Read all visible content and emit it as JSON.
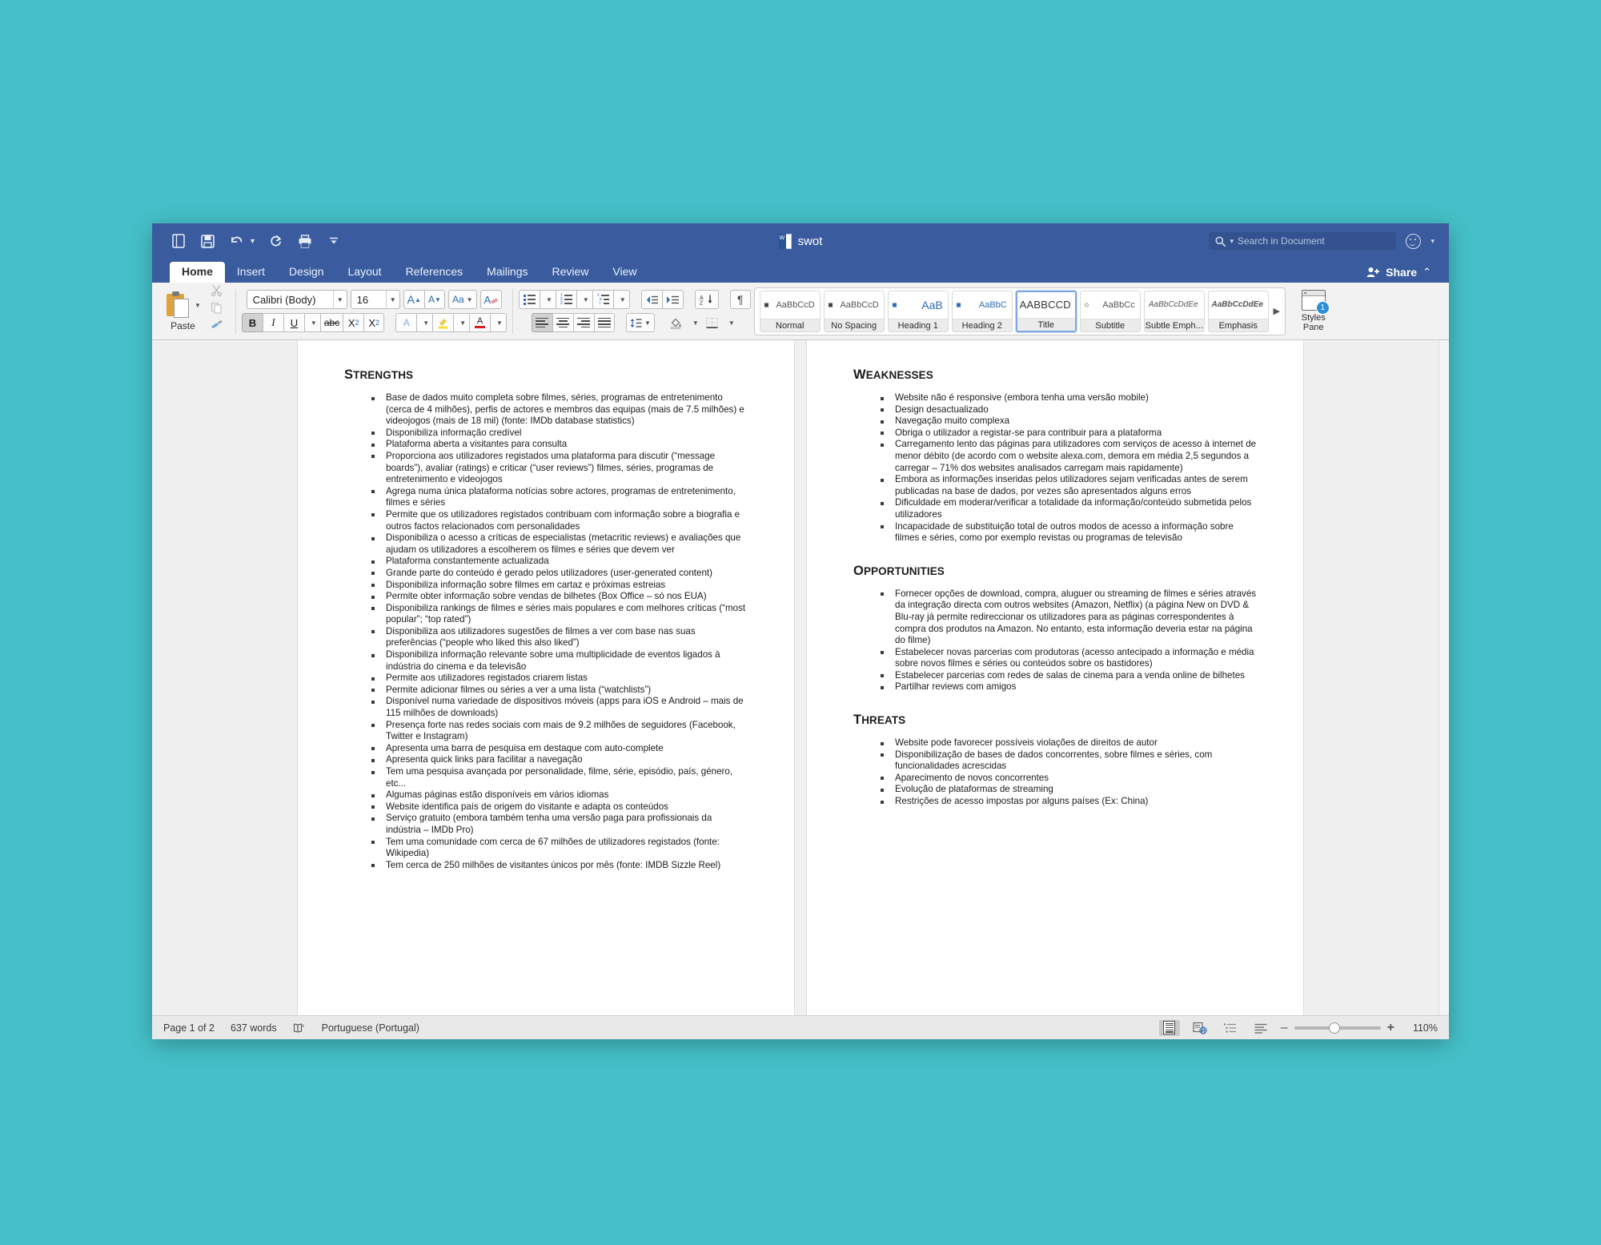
{
  "window": {
    "titlebar": {
      "document_name": "swot",
      "quick_access": [
        {
          "name": "new-document",
          "label": "New Document"
        },
        {
          "name": "save",
          "label": "Save"
        },
        {
          "name": "undo",
          "label": "Undo"
        },
        {
          "name": "redo",
          "label": "Redo"
        },
        {
          "name": "print",
          "label": "Print"
        },
        {
          "name": "customize-toolbar",
          "label": "Customize Toolbar"
        }
      ],
      "search": {
        "placeholder": "Search in Document"
      },
      "smiley_label": "Send a Smile"
    },
    "tabs": [
      {
        "label": "Home",
        "active": true
      },
      {
        "label": "Insert",
        "active": false
      },
      {
        "label": "Design",
        "active": false
      },
      {
        "label": "Layout",
        "active": false
      },
      {
        "label": "References",
        "active": false
      },
      {
        "label": "Mailings",
        "active": false
      },
      {
        "label": "Review",
        "active": false
      },
      {
        "label": "View",
        "active": false
      }
    ],
    "share": {
      "label": "Share",
      "chevron": "⌃"
    }
  },
  "ribbon": {
    "clipboard": {
      "paste_label": "Paste",
      "cut_label": "Cut",
      "copy_label": "Copy",
      "format_painter_label": "Format Painter"
    },
    "font": {
      "font_name": "Calibri (Body)",
      "font_size": "16",
      "grow_label": "A",
      "shrink_label": "A",
      "change_case_label": "Aa",
      "clear_formatting_label": "A",
      "bold_label": "B",
      "italic_label": "I",
      "underline_label": "U",
      "strikethrough_label": "abc",
      "subscript_label": "X",
      "subscript_sub": "2",
      "superscript_label": "X",
      "superscript_sup": "2",
      "text_effects_label": "A",
      "highlight_label": "A",
      "font_color_label": "A"
    },
    "paragraph": {
      "bullets_label": "Bullets",
      "numbering_label": "Numbering",
      "multilevel_label": "Multilevel List",
      "decrease_indent_label": "Decrease Indent",
      "increase_indent_label": "Increase Indent",
      "sort_label": "Sort",
      "show_marks_label": "¶",
      "align_left_label": "Align Left",
      "align_center_label": "Center",
      "align_right_label": "Align Right",
      "justify_label": "Justify",
      "line_spacing_label": "Line Spacing",
      "shading_label": "Shading",
      "borders_label": "Borders"
    },
    "styles": {
      "items": [
        {
          "name": "Normal",
          "preview": "AaBbCcD",
          "variant": "normal",
          "selected": false
        },
        {
          "name": "No Spacing",
          "preview": "AaBbCcD",
          "variant": "normal",
          "selected": false
        },
        {
          "name": "Heading 1",
          "preview": "AaB",
          "variant": "h1",
          "selected": false
        },
        {
          "name": "Heading 2",
          "preview": "AaBbC",
          "variant": "h2",
          "selected": false
        },
        {
          "name": "Title",
          "preview": "AABBCCD",
          "variant": "title",
          "selected": true
        },
        {
          "name": "Subtitle",
          "preview": "AaBbCc",
          "variant": "sub",
          "selected": false
        },
        {
          "name": "Subtle Emph...",
          "preview": "AaBbCcDdEe",
          "variant": "em",
          "selected": false
        },
        {
          "name": "Emphasis",
          "preview": "AaBbCcDdEe",
          "variant": "em",
          "selected": false
        }
      ],
      "next_label": "▶",
      "pane_label_line1": "Styles",
      "pane_label_line2": "Pane",
      "pane_badge": "1"
    }
  },
  "document": {
    "left_page": {
      "sections": [
        {
          "heading_first": "S",
          "heading_rest": "TRENGTHS",
          "bullets": [
            "Base de dados muito completa sobre filmes, séries, programas de entretenimento (cerca de 4 milhões), perfis de actores e membros das equipas (mais de 7.5 milhões) e videojogos (mais de 18 mil) (fonte: IMDb database statistics)",
            "Disponibiliza informação credível",
            "Plataforma aberta a visitantes para consulta",
            "Proporciona aos utilizadores registados uma plataforma para discutir (“message boards”), avaliar (ratings) e criticar (“user reviews”) filmes, séries, programas de entretenimento e videojogos",
            "Agrega numa única plataforma notícias sobre actores, programas de entretenimento, filmes e séries",
            "Permite que os utilizadores registados contribuam com informação sobre a biografia e outros factos relacionados com personalidades",
            "Disponibiliza o acesso a críticas de especialistas (metacritic reviews) e avaliações que ajudam os utilizadores a escolherem os filmes e séries que devem ver",
            "Plataforma constantemente actualizada",
            "Grande parte do conteúdo é gerado pelos utilizadores (user-generated content)",
            "Disponibiliza informação sobre filmes em cartaz e próximas estreias",
            "Permite obter informação sobre vendas de bilhetes (Box Office – só nos EUA)",
            "Disponibiliza rankings de filmes e séries mais populares e com melhores críticas (“most popular”; “top rated”)",
            "Disponibiliza aos utilizadores sugestões de filmes a ver com base nas suas preferências (“people who liked this also liked”)",
            "Disponibiliza informação relevante sobre uma multiplicidade de eventos ligados à indústria do cinema e da televisão",
            "Permite aos utilizadores registados criarem listas",
            "Permite adicionar filmes ou séries a ver a uma lista (“watchlists”)",
            "Disponível numa variedade de dispositivos móveis (apps para iOS e Android – mais de 115 milhões de downloads)",
            "Presença forte nas redes sociais com mais de 9.2 milhões de seguidores (Facebook, Twitter e Instagram)",
            "Apresenta uma barra de pesquisa em destaque com auto-complete",
            "Apresenta quick links para facilitar a navegação",
            "Tem uma pesquisa avançada por personalidade, filme, série, episódio, país, género, etc...",
            "Algumas páginas estão disponíveis em vários idiomas",
            "Website identifica país de origem do visitante e adapta os conteúdos",
            "Serviço gratuito (embora também tenha uma versão paga para profissionais da indústria – IMDb Pro)",
            "Tem uma comunidade com cerca de 67 milhões de utilizadores registados (fonte: Wikipedia)",
            "Tem cerca de 250 milhões de visitantes únicos por mês (fonte: IMDB Sizzle Reel)"
          ]
        }
      ]
    },
    "right_page": {
      "sections": [
        {
          "heading_first": "W",
          "heading_rest": "EAKNESSES",
          "bullets": [
            "Website não é responsive (embora tenha uma versão mobile)",
            "Design desactualizado",
            "Navegação muito complexa",
            "Obriga o utilizador a registar-se para contribuir para a plataforma",
            "Carregamento lento das páginas para utilizadores com serviços de acesso à internet de menor débito (de acordo com o website alexa.com, demora em média 2,5 segundos a carregar – 71% dos websites analisados carregam mais rapidamente)",
            "Embora as informações inseridas pelos utilizadores sejam verificadas antes de serem publicadas na base de dados, por vezes são apresentados alguns erros",
            "Dificuldade em moderar/verificar a totalidade da informação/conteúdo submetida pelos utilizadores",
            "Incapacidade de substituição total de outros modos de acesso a informação sobre filmes e séries, como por exemplo revistas ou programas de televisão"
          ]
        },
        {
          "heading_first": "O",
          "heading_rest": "PPORTUNITIES",
          "bullets": [
            "Fornecer opções de download, compra, aluguer ou streaming de filmes e séries através da integração directa com outros websites (Amazon, Netflix) (a página New on DVD & Blu-ray já permite redireccionar os utilizadores para as páginas correspondentes à compra dos produtos na Amazon. No entanto, esta informação deveria estar na página do filme)",
            "Estabelecer novas parcerias com produtoras (acesso antecipado a informação e média sobre novos filmes e séries ou conteúdos sobre os bastidores)",
            "Estabelecer parcerias com redes de salas de cinema para a venda online de bilhetes",
            "Partilhar reviews com amigos"
          ]
        },
        {
          "heading_first": "T",
          "heading_rest": "HREATS",
          "bullets": [
            "Website pode favorecer possíveis violações de direitos de autor",
            "Disponibilização de bases de dados concorrentes, sobre filmes e séries, com funcionalidades acrescidas",
            "Aparecimento de novos concorrentes",
            "Evolução de plataformas de streaming",
            "Restrições de acesso impostas por alguns países (Ex: China)"
          ]
        }
      ]
    }
  },
  "statusbar": {
    "page_info": "Page 1 of 2",
    "word_count": "637 words",
    "proofing_label": "Proofing Errors",
    "language": "Portuguese (Portugal)",
    "views": [
      {
        "name": "print-layout-view",
        "active": true
      },
      {
        "name": "web-layout-view",
        "active": false
      },
      {
        "name": "outline-view",
        "active": false
      },
      {
        "name": "draft-view",
        "active": false
      }
    ],
    "zoom_out": "–",
    "zoom_in": "+",
    "zoom_level": "110%"
  },
  "colors": {
    "desktop": "#45C0C8",
    "titlebar": "#3A5C9E",
    "ribbon": "#F2F2F2",
    "accent_blue": "#2C6DB5"
  }
}
